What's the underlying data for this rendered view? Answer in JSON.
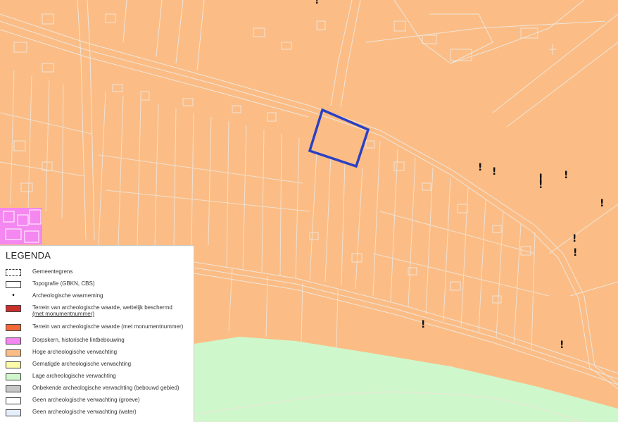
{
  "colors": {
    "hoge": "#fbbd85",
    "lage": "#cff7cc",
    "dorpskern": "#f487f0",
    "beschermd": "#c9302c",
    "monumentnummer": "#f2693a",
    "gematigde": "#fbfba9",
    "onbekende": "#c6c6c6",
    "groeve": "#ffffff",
    "water": "#e6eefb",
    "plangebied": "#2a3fc4",
    "topografie": "#f3e7dd"
  },
  "observations": {
    "symbol": "!",
    "count": 12
  },
  "legend": {
    "title": "LEGENDA",
    "items": [
      {
        "key": "gemeentegrens",
        "label": "Gemeentegrens",
        "swatch": "dashed"
      },
      {
        "key": "topografie",
        "label": "Topografie (GBKN, CBS)",
        "swatch": "#ffffff"
      },
      {
        "key": "waarneming",
        "label": "Archeologische waarneming",
        "swatch": "dot"
      },
      {
        "key": "beschermd",
        "label": "Terrein van archeologische waarde, wettelijk beschermd",
        "label2": "(met monumentnummer)",
        "swatch": "#c9302c"
      },
      {
        "key": "monumentnummer",
        "label": "Terrein van archeologische waarde (met monumentnummer)",
        "swatch": "#f2693a"
      },
      {
        "key": "dorpskern",
        "label": "Dorpskern, historische lintbebouwing",
        "swatch": "#f487f0"
      },
      {
        "key": "hoge",
        "label": "Hoge archeologische verwachting",
        "swatch": "#fbbd85"
      },
      {
        "key": "gematigde",
        "label": "Gematigde archeologische verwachting",
        "swatch": "#fbfba9"
      },
      {
        "key": "lage",
        "label": "Lage archeologische verwachting",
        "swatch": "#cff7cc"
      },
      {
        "key": "onbekende",
        "label": "Onbekende archeologische verwachting (bebouwd gebied)",
        "swatch": "#c6c6c6"
      },
      {
        "key": "groeve",
        "label": "Geen archeologische verwachting (groeve)",
        "swatch": "#ffffff"
      },
      {
        "key": "water",
        "label": "Geen archeologische verwachting (water)",
        "swatch": "#e6eefb"
      }
    ]
  }
}
